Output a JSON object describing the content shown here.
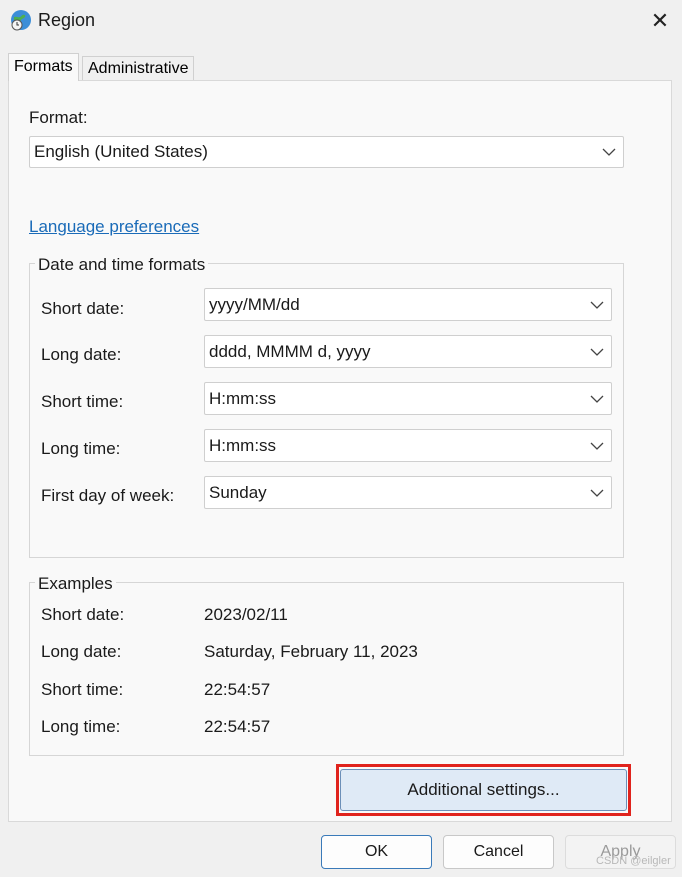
{
  "window": {
    "title": "Region",
    "close_glyph": "✕"
  },
  "tabs": [
    {
      "label": "Formats",
      "active": true
    },
    {
      "label": "Administrative",
      "active": false
    }
  ],
  "format": {
    "label": "Format:",
    "value": "English (United States)"
  },
  "language_link": "Language preferences",
  "date_time_formats": {
    "legend": "Date and time formats",
    "rows": [
      {
        "label": "Short date:",
        "value": "yyyy/MM/dd"
      },
      {
        "label": "Long date:",
        "value": "dddd, MMMM d, yyyy"
      },
      {
        "label": "Short time:",
        "value": "H:mm:ss"
      },
      {
        "label": "Long time:",
        "value": "H:mm:ss"
      },
      {
        "label": "First day of week:",
        "value": "Sunday"
      }
    ]
  },
  "examples": {
    "legend": "Examples",
    "rows": [
      {
        "label": "Short date:",
        "value": "2023/02/11"
      },
      {
        "label": "Long date:",
        "value": "Saturday, February 11, 2023"
      },
      {
        "label": "Short time:",
        "value": "22:54:57"
      },
      {
        "label": "Long time:",
        "value": "22:54:57"
      }
    ]
  },
  "additional_settings_label": "Additional settings...",
  "buttons": {
    "ok": "OK",
    "cancel": "Cancel",
    "apply": "Apply"
  },
  "watermark": "CSDN @eilgler",
  "colors": {
    "link": "#1a6bb8",
    "highlight": "#e0231d",
    "primary_border": "#3a7ab9"
  }
}
